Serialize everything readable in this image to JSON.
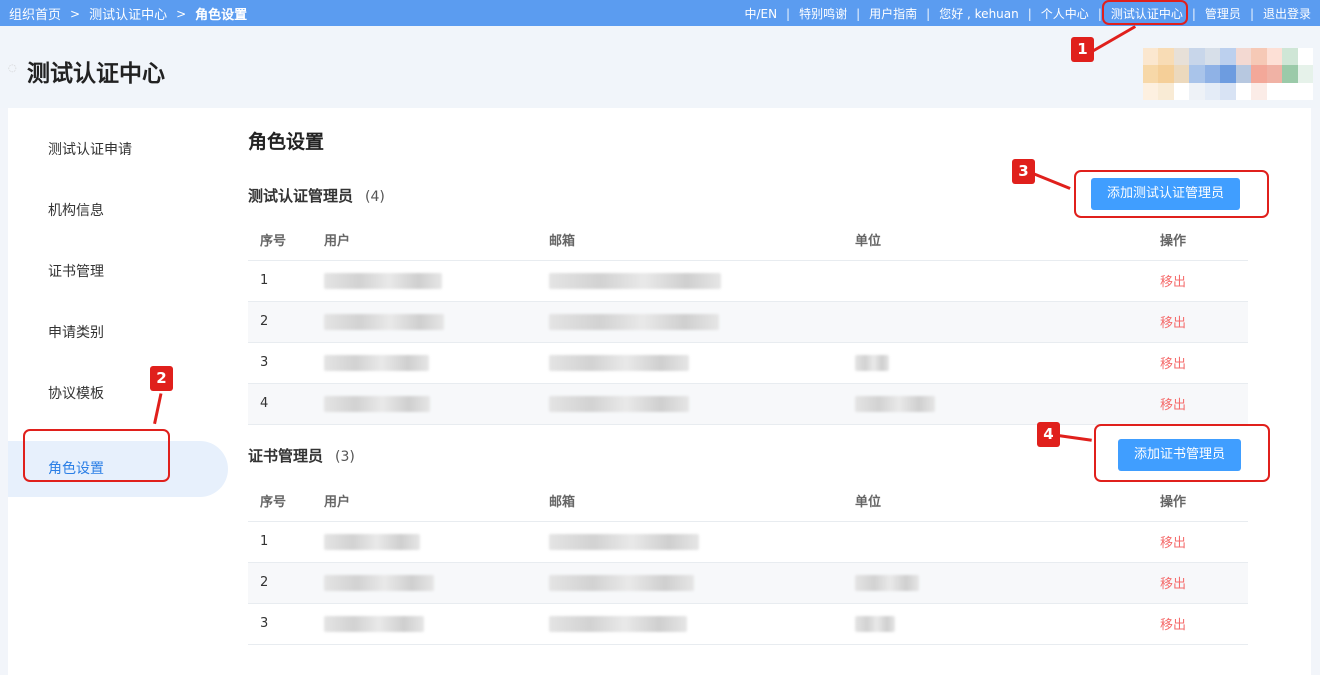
{
  "breadcrumb": {
    "items": [
      "组织首页",
      "测试认证中心",
      "角色设置"
    ],
    "separator": ">"
  },
  "top_links": [
    "中/EN",
    "特别鸣谢",
    "用户指南",
    "您好 , kehuan",
    "个人中心",
    "测试认证中心",
    "管理员",
    "退出登录"
  ],
  "header": {
    "title": "测试认证中心"
  },
  "sidebar": {
    "items": [
      {
        "label": "测试认证申请"
      },
      {
        "label": "机构信息"
      },
      {
        "label": "证书管理"
      },
      {
        "label": "申请类别"
      },
      {
        "label": "协议模板"
      },
      {
        "label": "角色设置",
        "active": true
      }
    ]
  },
  "main": {
    "title": "角色设置",
    "columns": [
      "序号",
      "用户",
      "邮箱",
      "单位",
      "操作"
    ],
    "section1": {
      "title": "测试认证管理员",
      "count": "(4)",
      "add_label": "添加测试认证管理员",
      "rows": [
        {
          "no": "1",
          "action": "移出"
        },
        {
          "no": "2",
          "action": "移出"
        },
        {
          "no": "3",
          "action": "移出"
        },
        {
          "no": "4",
          "action": "移出"
        }
      ]
    },
    "section2": {
      "title": "证书管理员",
      "count": "(3)",
      "add_label": "添加证书管理员",
      "rows": [
        {
          "no": "1",
          "action": "移出"
        },
        {
          "no": "2",
          "action": "移出"
        },
        {
          "no": "3",
          "action": "移出"
        }
      ]
    }
  },
  "annotations": {
    "markers": [
      "1",
      "2",
      "3",
      "4"
    ]
  },
  "colors": {
    "topbar": "#5b9cf0",
    "primary": "#409eff",
    "danger": "#f56c6c",
    "annotation": "#e0201c"
  }
}
